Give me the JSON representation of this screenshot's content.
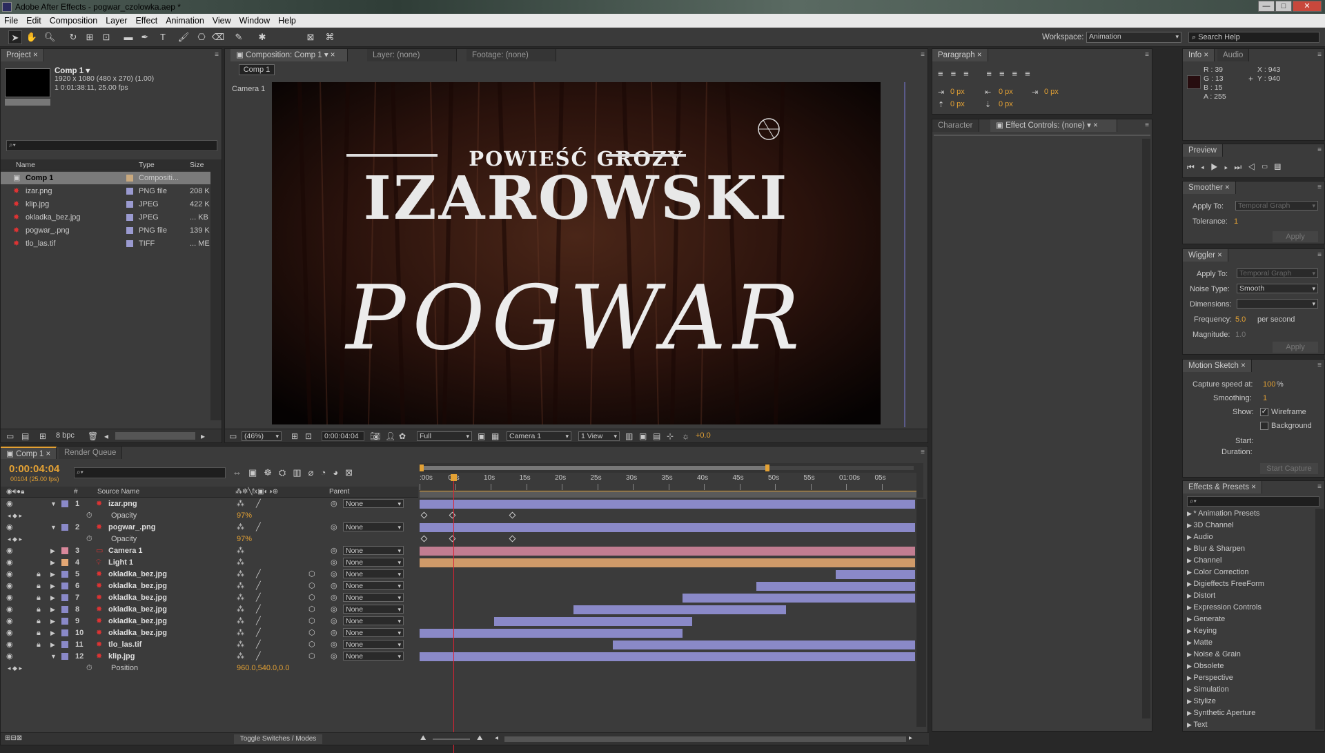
{
  "window": {
    "title": "Adobe After Effects - pogwar_czolowka.aep *",
    "minimize": "—",
    "maximize": "□",
    "close": "✕"
  },
  "menu": [
    "File",
    "Edit",
    "Composition",
    "Layer",
    "Effect",
    "Animation",
    "View",
    "Window",
    "Help"
  ],
  "toolbar": {
    "workspace_label": "Workspace:",
    "workspace_value": "Animation",
    "search_help": "Search Help"
  },
  "project": {
    "tab": "Project",
    "comp_name": "Comp 1 ▾",
    "comp_info1": "1920 x 1080  (480 x 270) (1.00)",
    "comp_info2": "1 0:01:38:11, 25.00 fps",
    "search_placeholder": "",
    "columns": {
      "name": "Name",
      "type": "Type",
      "size": "Size"
    },
    "items": [
      {
        "name": "Comp 1",
        "type": "Compositi...",
        "size": "",
        "selected": true
      },
      {
        "name": "izar.png",
        "type": "PNG file",
        "size": "208 K"
      },
      {
        "name": "klip.jpg",
        "type": "JPEG",
        "size": "422 K"
      },
      {
        "name": "okladka_bez.jpg",
        "type": "JPEG",
        "size": "... KB"
      },
      {
        "name": "pogwar_.png",
        "type": "PNG file",
        "size": "139 K"
      },
      {
        "name": "tlo_las.tif",
        "type": "TIFF",
        "size": "... ME"
      }
    ],
    "bpc": "8 bpc"
  },
  "composition": {
    "tab": "Composition: Comp 1",
    "layer_tab": "Layer: (none)",
    "footage_tab": "Footage: (none)",
    "subtab": "Comp 1",
    "camera_label": "Camera 1",
    "canvas": {
      "subtitle": "POWIEŚĆ GROZY",
      "title": "IZAROWSKI",
      "main": "POGWAR"
    },
    "footer": {
      "zoom": "(46%)",
      "time": "0:00:04:04",
      "resolution": "Full",
      "camera": "Camera 1",
      "views": "1 View",
      "exposure": "+0.0"
    }
  },
  "paragraph": {
    "tab": "Paragraph",
    "values": [
      "0 px",
      "0 px",
      "0 px",
      "0 px",
      "0 px"
    ]
  },
  "character": {
    "tab": "Character",
    "effect_controls_tab": "Effect Controls: (none)"
  },
  "info": {
    "tab": "Info",
    "audio_tab": "Audio",
    "r": "R : 39",
    "g": "G : 13",
    "b": "B : 15",
    "a": "A : 255",
    "x": "X : 943",
    "y": "Y : 940",
    "swatch": "#270d0f"
  },
  "preview": {
    "tab": "Preview"
  },
  "smoother": {
    "tab": "Smoother",
    "apply_to_label": "Apply To:",
    "apply_to_value": "Temporal Graph",
    "tolerance_label": "Tolerance:",
    "tolerance_value": "1",
    "apply": "Apply"
  },
  "wiggler": {
    "tab": "Wiggler",
    "apply_to_label": "Apply To:",
    "apply_to_value": "Temporal Graph",
    "noise_label": "Noise Type:",
    "noise_value": "Smooth",
    "dim_label": "Dimensions:",
    "dim_value": "",
    "freq_label": "Frequency:",
    "freq_value": "5.0",
    "freq_unit": "per second",
    "mag_label": "Magnitude:",
    "mag_value": "1.0",
    "apply": "Apply"
  },
  "motion_sketch": {
    "tab": "Motion Sketch",
    "speed_label": "Capture speed at:",
    "speed_value": "100",
    "speed_unit": "%",
    "smoothing_label": "Smoothing:",
    "smoothing_value": "1",
    "show_label": "Show:",
    "wireframe": "Wireframe",
    "background": "Background",
    "start_label": "Start:",
    "duration_label": "Duration:",
    "start_capture": "Start Capture"
  },
  "effects": {
    "tab": "Effects & Presets",
    "items": [
      "* Animation Presets",
      "3D Channel",
      "Audio",
      "Blur & Sharpen",
      "Channel",
      "Color Correction",
      "Digieffects FreeForm",
      "Distort",
      "Expression Controls",
      "Generate",
      "Keying",
      "Matte",
      "Noise & Grain",
      "Obsolete",
      "Perspective",
      "Simulation",
      "Stylize",
      "Synthetic Aperture",
      "Text"
    ]
  },
  "timeline": {
    "tab": "Comp 1",
    "render_tab": "Render Queue",
    "timecode": "0:00:04:04",
    "frame_info": "00104 (25.00 fps)",
    "col_num": "#",
    "col_source": "Source Name",
    "col_parent": "Parent",
    "ruler": [
      ":00s",
      "05s",
      "10s",
      "15s",
      "20s",
      "25s",
      "30s",
      "35s",
      "40s",
      "45s",
      "50s",
      "55s",
      "01:00s",
      "05s"
    ],
    "layers": [
      {
        "num": "1",
        "name": "izar.png",
        "color": "#8a89c8",
        "parent": "None",
        "expanded": true,
        "prop": "Opacity",
        "prop_val": "97%"
      },
      {
        "num": "2",
        "name": "pogwar_.png",
        "color": "#8a89c8",
        "parent": "None",
        "expanded": true,
        "prop": "Opacity",
        "prop_val": "97%"
      },
      {
        "num": "3",
        "name": "Camera 1",
        "color": "#d9889b",
        "parent": "None"
      },
      {
        "num": "4",
        "name": "Light 1",
        "color": "#e3a774",
        "parent": "None"
      },
      {
        "num": "5",
        "name": "okladka_bez.jpg",
        "color": "#8a89c8",
        "parent": "None"
      },
      {
        "num": "6",
        "name": "okladka_bez.jpg",
        "color": "#8a89c8",
        "parent": "None"
      },
      {
        "num": "7",
        "name": "okladka_bez.jpg",
        "color": "#8a89c8",
        "parent": "None"
      },
      {
        "num": "8",
        "name": "okladka_bez.jpg",
        "color": "#8a89c8",
        "parent": "None"
      },
      {
        "num": "9",
        "name": "okladka_bez.jpg",
        "color": "#8a89c8",
        "parent": "None"
      },
      {
        "num": "10",
        "name": "okladka_bez.jpg",
        "color": "#8a89c8",
        "parent": "None"
      },
      {
        "num": "11",
        "name": "tlo_las.tif",
        "color": "#8a89c8",
        "parent": "None"
      },
      {
        "num": "12",
        "name": "klip.jpg",
        "color": "#8a89c8",
        "parent": "None",
        "expanded": true,
        "prop": "Position",
        "prop_val": "960.0,540.0,0.0"
      }
    ],
    "toggle": "Toggle Switches / Modes"
  }
}
